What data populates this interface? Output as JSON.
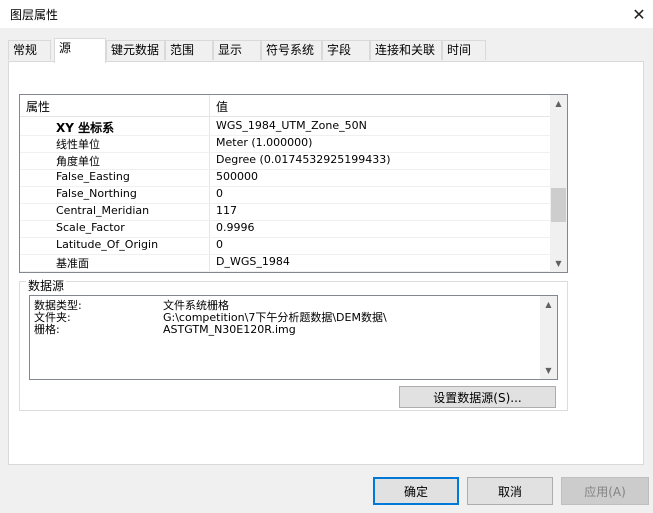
{
  "window": {
    "title": "图层属性"
  },
  "tabs": [
    {
      "label": "常规"
    },
    {
      "label": "源"
    },
    {
      "label": "键元数据"
    },
    {
      "label": "范围"
    },
    {
      "label": "显示"
    },
    {
      "label": "符号系统"
    },
    {
      "label": "字段"
    },
    {
      "label": "连接和关联"
    },
    {
      "label": "时间"
    }
  ],
  "active_tab": "源",
  "property_grid": {
    "headers": {
      "property": "属性",
      "value": "值"
    },
    "rows": [
      {
        "key": "XY 坐标系",
        "value": "WGS_1984_UTM_Zone_50N"
      },
      {
        "key": "线性单位",
        "value": "Meter (1.000000)"
      },
      {
        "key": "角度单位",
        "value": "Degree (0.0174532925199433)"
      },
      {
        "key": "False_Easting",
        "value": "500000"
      },
      {
        "key": "False_Northing",
        "value": "0"
      },
      {
        "key": "Central_Meridian",
        "value": "117"
      },
      {
        "key": "Scale_Factor",
        "value": "0.9996"
      },
      {
        "key": "Latitude_Of_Origin",
        "value": "0"
      },
      {
        "key": "基准面",
        "value": "D_WGS_1984"
      }
    ]
  },
  "datasource": {
    "group_label": "数据源",
    "lines": [
      {
        "label": "数据类型:",
        "value": "文件系统栅格"
      },
      {
        "label": "文件夹:",
        "value": "G:\\competition\\7下午分析题数据\\DEM数据\\"
      },
      {
        "label": "栅格:",
        "value": "ASTGTM_N30E120R.img"
      }
    ],
    "set_button": "设置数据源(S)..."
  },
  "buttons": {
    "ok": "确定",
    "cancel": "取消",
    "apply": "应用(A)"
  },
  "icons": {
    "close": "close-icon",
    "scroll_up": "chevron-up-icon",
    "scroll_down": "chevron-down-icon"
  }
}
